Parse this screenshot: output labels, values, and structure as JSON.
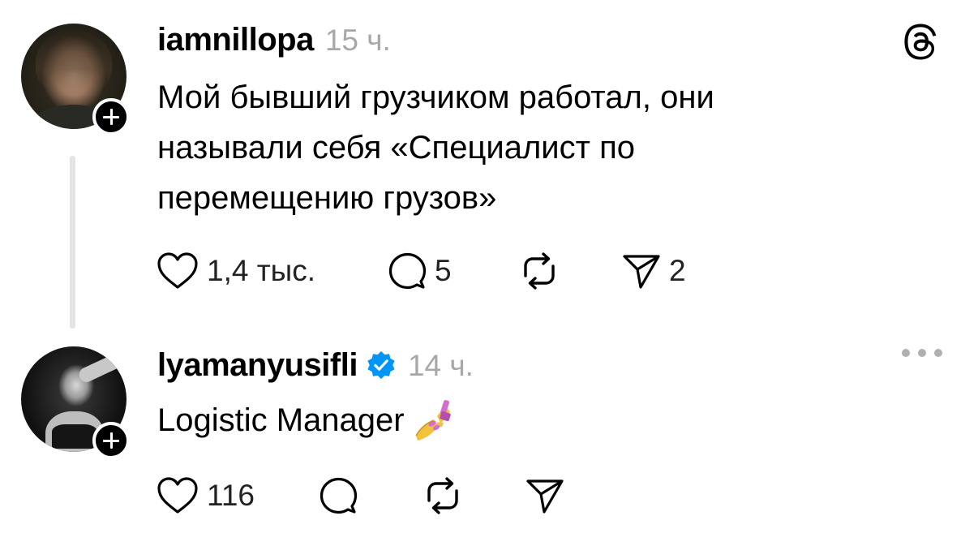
{
  "posts": [
    {
      "username": "iamnillopa",
      "time": "15 ч.",
      "verified": false,
      "text_lines": [
        "Мой бывший грузчиком работал, они",
        "называли себя «Специалист по",
        "перемещению грузов»"
      ],
      "likes": "1,4 тыс.",
      "replies": "5",
      "reposts": "",
      "shares": "2",
      "icons": [
        "heart-icon",
        "comment-icon",
        "repost-icon",
        "share-icon",
        "threads-logo-icon",
        "plus-icon"
      ]
    },
    {
      "username": "lyamanyusifli",
      "time": "14 ч.",
      "verified": true,
      "text": "Logistic Manager",
      "emoji": "nail-polish-emoji",
      "likes": "116",
      "replies": "",
      "reposts": "",
      "shares": "",
      "icons": [
        "heart-icon",
        "comment-icon",
        "repost-icon",
        "share-icon",
        "more-icon",
        "verified-badge-icon",
        "plus-icon"
      ]
    }
  ],
  "colors": {
    "text": "#000000",
    "muted": "#a8a8a8",
    "verified": "#0095f6",
    "thread_line": "#e4e4e4"
  }
}
